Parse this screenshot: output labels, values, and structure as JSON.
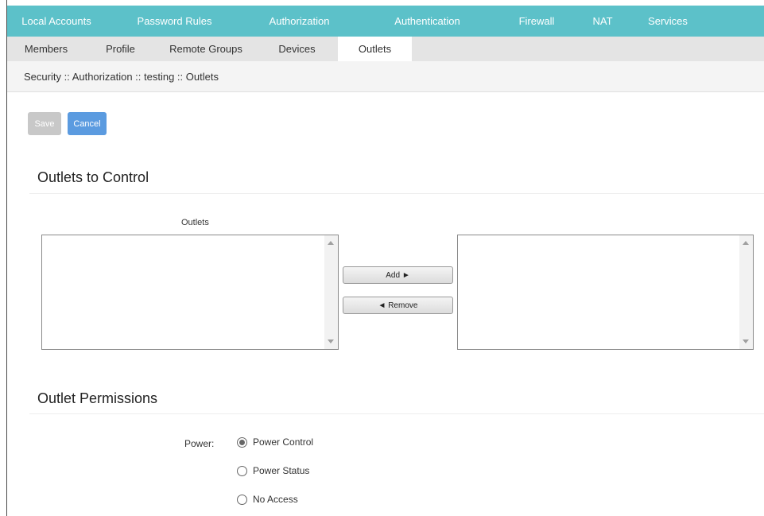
{
  "top_tabs": [
    {
      "label": "Local Accounts"
    },
    {
      "label": "Password Rules"
    },
    {
      "label": "Authorization"
    },
    {
      "label": "Authentication"
    },
    {
      "label": "Firewall"
    },
    {
      "label": "NAT"
    },
    {
      "label": "Services"
    }
  ],
  "sub_tabs": [
    {
      "label": "Members"
    },
    {
      "label": "Profile"
    },
    {
      "label": "Remote Groups"
    },
    {
      "label": "Devices"
    },
    {
      "label": "Outlets"
    }
  ],
  "breadcrumb": "Security :: Authorization :: testing :: Outlets",
  "toolbar": {
    "save_label": "Save",
    "cancel_label": "Cancel"
  },
  "outlets_section": {
    "title": "Outlets to Control",
    "list_label": "Outlets",
    "add_label": "Add ►",
    "remove_label": "◄ Remove"
  },
  "permissions_section": {
    "title": "Outlet Permissions",
    "power_label": "Power:",
    "options": [
      {
        "label": "Power Control",
        "checked": true
      },
      {
        "label": "Power Status",
        "checked": false
      },
      {
        "label": "No Access",
        "checked": false
      }
    ]
  },
  "colors": {
    "accent": "#5cc1c9",
    "cancel": "#5b9be0",
    "save_disabled": "#c8c8c8"
  }
}
